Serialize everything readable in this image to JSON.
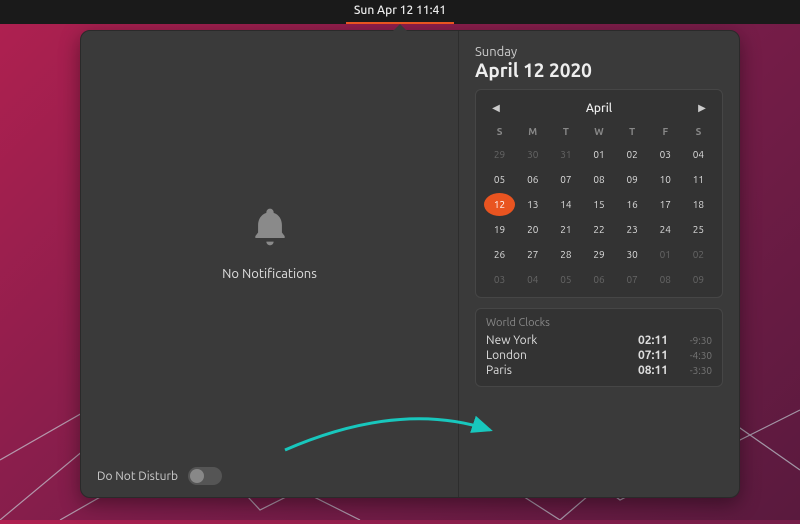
{
  "topbar": {
    "clock": "Sun Apr 12  11:41"
  },
  "notifications": {
    "empty_text": "No Notifications",
    "dnd_label": "Do Not Disturb"
  },
  "date": {
    "dow": "Sunday",
    "full": "April 12 2020"
  },
  "calendar": {
    "month": "April",
    "dow": [
      "S",
      "M",
      "T",
      "W",
      "T",
      "F",
      "S"
    ],
    "weeks": [
      [
        {
          "d": "29",
          "o": 1
        },
        {
          "d": "30",
          "o": 1
        },
        {
          "d": "31",
          "o": 1
        },
        {
          "d": "01"
        },
        {
          "d": "02"
        },
        {
          "d": "03"
        },
        {
          "d": "04"
        }
      ],
      [
        {
          "d": "05"
        },
        {
          "d": "06"
        },
        {
          "d": "07"
        },
        {
          "d": "08"
        },
        {
          "d": "09"
        },
        {
          "d": "10"
        },
        {
          "d": "11"
        }
      ],
      [
        {
          "d": "12",
          "t": 1
        },
        {
          "d": "13"
        },
        {
          "d": "14"
        },
        {
          "d": "15"
        },
        {
          "d": "16"
        },
        {
          "d": "17"
        },
        {
          "d": "18"
        }
      ],
      [
        {
          "d": "19"
        },
        {
          "d": "20"
        },
        {
          "d": "21"
        },
        {
          "d": "22"
        },
        {
          "d": "23"
        },
        {
          "d": "24"
        },
        {
          "d": "25"
        }
      ],
      [
        {
          "d": "26"
        },
        {
          "d": "27"
        },
        {
          "d": "28"
        },
        {
          "d": "29"
        },
        {
          "d": "30"
        },
        {
          "d": "01",
          "o": 1
        },
        {
          "d": "02",
          "o": 1
        }
      ],
      [
        {
          "d": "03",
          "o": 1
        },
        {
          "d": "04",
          "o": 1
        },
        {
          "d": "05",
          "o": 1
        },
        {
          "d": "06",
          "o": 1
        },
        {
          "d": "07",
          "o": 1
        },
        {
          "d": "08",
          "o": 1
        },
        {
          "d": "09",
          "o": 1
        }
      ]
    ]
  },
  "world_clocks": {
    "title": "World Clocks",
    "rows": [
      {
        "city": "New York",
        "time": "02:11",
        "offset": "-9:30"
      },
      {
        "city": "London",
        "time": "07:11",
        "offset": "-4:30"
      },
      {
        "city": "Paris",
        "time": "08:11",
        "offset": "-3:30"
      }
    ]
  },
  "colors": {
    "accent": "#e95420"
  }
}
